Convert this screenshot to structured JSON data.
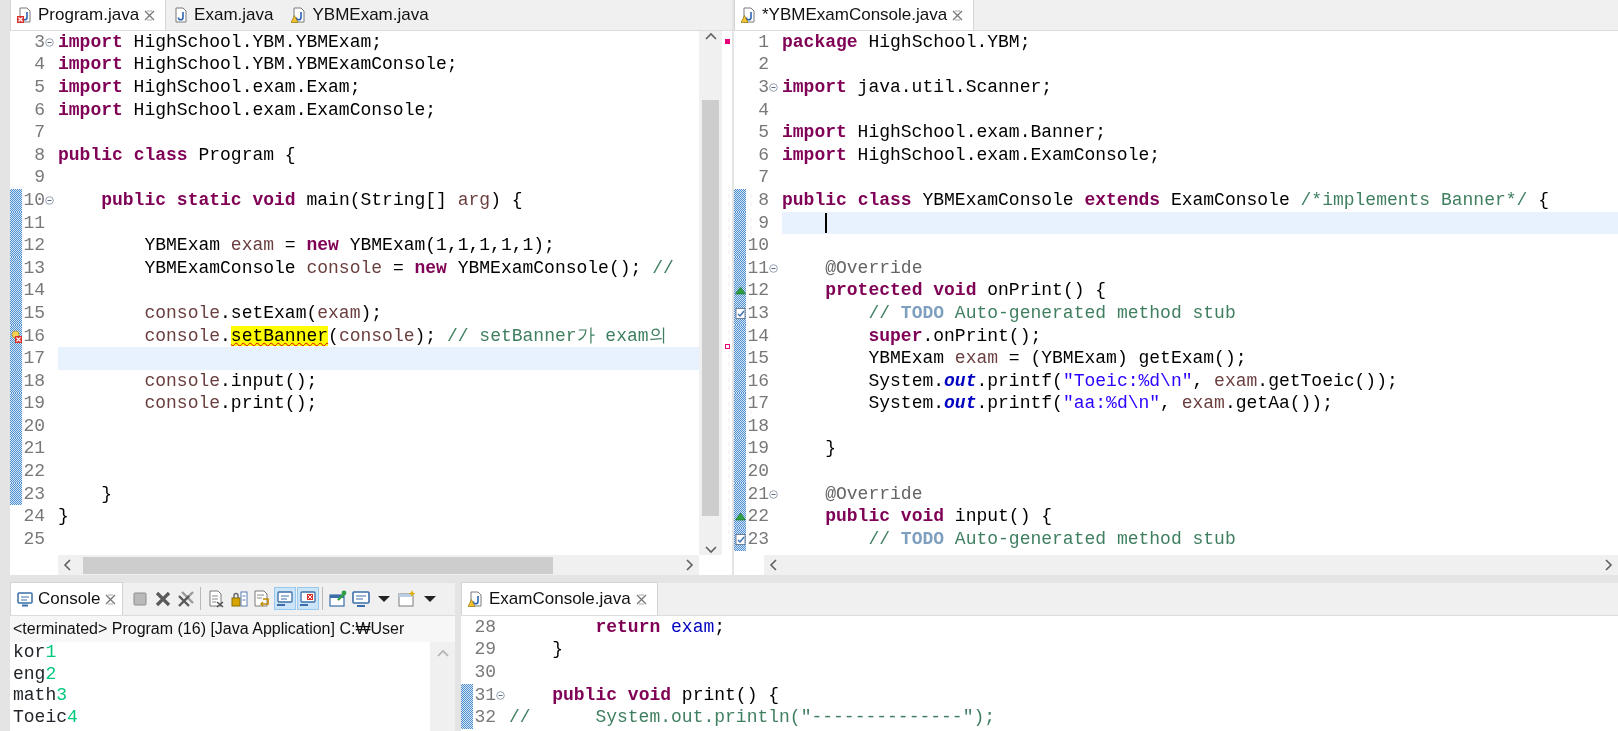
{
  "left_editor": {
    "cursor": false,
    "tabs": [
      {
        "label": "Program.java",
        "kind": "java-error",
        "selected": true
      },
      {
        "label": "Exam.java",
        "kind": "java",
        "selected": false
      },
      {
        "label": "YBMExam.java",
        "kind": "java-warning",
        "selected": false
      }
    ],
    "lines": [
      {
        "number": "3",
        "kind": "fold",
        "changed": false,
        "current": false,
        "tokens": [
          {
            "kind": "keyword",
            "text": "import"
          },
          {
            "kind": "plain",
            "text": " HighSchool.YBM.YBMExam;"
          }
        ]
      },
      {
        "number": "4",
        "kind": "plain",
        "changed": false,
        "current": false,
        "tokens": [
          {
            "kind": "keyword",
            "text": "import"
          },
          {
            "kind": "plain",
            "text": " HighSchool.YBM.YBMExamConsole;"
          }
        ]
      },
      {
        "number": "5",
        "kind": "plain",
        "changed": false,
        "current": false,
        "tokens": [
          {
            "kind": "keyword",
            "text": "import"
          },
          {
            "kind": "plain",
            "text": " HighSchool.exam.Exam;"
          }
        ]
      },
      {
        "number": "6",
        "kind": "plain",
        "changed": false,
        "current": false,
        "tokens": [
          {
            "kind": "keyword",
            "text": "import"
          },
          {
            "kind": "plain",
            "text": " HighSchool.exam.ExamConsole;"
          }
        ]
      },
      {
        "number": "7",
        "kind": "plain",
        "changed": false,
        "current": false
      },
      {
        "number": "8",
        "kind": "plain",
        "changed": false,
        "current": false,
        "tokens": [
          {
            "kind": "keyword",
            "text": "public "
          },
          {
            "kind": "keyword",
            "text": "class"
          },
          {
            "kind": "plain",
            "text": " Program {"
          }
        ]
      },
      {
        "number": "9",
        "kind": "plain",
        "changed": false,
        "current": false
      },
      {
        "number": "10",
        "kind": "fold",
        "changed": true,
        "current": false,
        "tokens": [
          {
            "kind": "keyword",
            "text": "    public "
          },
          {
            "kind": "keyword",
            "text": "static "
          },
          {
            "kind": "keyword",
            "text": "void"
          },
          {
            "kind": "plain",
            "text": " main(String[] "
          },
          {
            "kind": "local",
            "text": "arg"
          },
          {
            "kind": "plain",
            "text": ") {"
          }
        ]
      },
      {
        "number": "11",
        "kind": "plain",
        "changed": true,
        "current": false
      },
      {
        "number": "12",
        "kind": "plain",
        "changed": true,
        "current": false,
        "tokens": [
          {
            "kind": "plain",
            "text": "        YBMExam "
          },
          {
            "kind": "local",
            "text": "exam"
          },
          {
            "kind": "plain",
            "text": " = "
          },
          {
            "kind": "keyword",
            "text": "new"
          },
          {
            "kind": "plain",
            "text": " YBMExam(1,1,1,1,1);"
          }
        ]
      },
      {
        "number": "13",
        "kind": "plain",
        "changed": true,
        "current": false,
        "tokens": [
          {
            "kind": "plain",
            "text": "        YBMExamConsole "
          },
          {
            "kind": "local",
            "text": "console"
          },
          {
            "kind": "plain",
            "text": " = "
          },
          {
            "kind": "keyword",
            "text": "new"
          },
          {
            "kind": "plain",
            "text": " YBMExamConsole(); "
          },
          {
            "kind": "comment",
            "text": "//"
          }
        ]
      },
      {
        "number": "14",
        "kind": "plain",
        "changed": true,
        "current": false
      },
      {
        "number": "15",
        "kind": "plain",
        "changed": true,
        "current": false,
        "tokens": [
          {
            "kind": "local",
            "text": "        console"
          },
          {
            "kind": "plain",
            "text": ".setExam("
          },
          {
            "kind": "local",
            "text": "exam"
          },
          {
            "kind": "plain",
            "text": ");"
          }
        ]
      },
      {
        "number": "16",
        "kind": "error",
        "changed": true,
        "current": false,
        "tokens": [
          {
            "kind": "local",
            "text": "        console"
          },
          {
            "kind": "plain",
            "text": "."
          },
          {
            "kind": "error",
            "text": "setBanner"
          },
          {
            "kind": "plain",
            "text": "("
          },
          {
            "kind": "local",
            "text": "console"
          },
          {
            "kind": "plain",
            "text": "); "
          },
          {
            "kind": "comment",
            "text": "// setBanner가 exam의"
          }
        ]
      },
      {
        "number": "17",
        "kind": "plain",
        "changed": true,
        "current": true
      },
      {
        "number": "18",
        "kind": "plain",
        "changed": true,
        "current": false,
        "tokens": [
          {
            "kind": "local",
            "text": "        console"
          },
          {
            "kind": "plain",
            "text": ".input();"
          }
        ]
      },
      {
        "number": "19",
        "kind": "plain",
        "changed": true,
        "current": false,
        "tokens": [
          {
            "kind": "local",
            "text": "        console"
          },
          {
            "kind": "plain",
            "text": ".print();"
          }
        ]
      },
      {
        "number": "20",
        "kind": "plain",
        "changed": true,
        "current": false
      },
      {
        "number": "21",
        "kind": "plain",
        "changed": true,
        "current": false
      },
      {
        "number": "22",
        "kind": "plain",
        "changed": true,
        "current": false
      },
      {
        "number": "23",
        "kind": "plain",
        "changed": true,
        "current": false,
        "tokens": [
          {
            "kind": "plain",
            "text": "    }"
          }
        ]
      },
      {
        "number": "24",
        "kind": "plain",
        "changed": false,
        "current": false,
        "tokens": [
          {
            "kind": "plain",
            "text": "}"
          }
        ]
      },
      {
        "number": "25",
        "kind": "plain",
        "changed": false,
        "current": false
      }
    ]
  },
  "right_editor": {
    "cursor": true,
    "tabs": [
      {
        "label": "*YBMExamConsole.java",
        "kind": "java-warning",
        "selected": true
      }
    ],
    "lines": [
      {
        "number": "1",
        "kind": "plain",
        "changed": false,
        "current": false,
        "tokens": [
          {
            "kind": "keyword",
            "text": "package"
          },
          {
            "kind": "plain",
            "text": " HighSchool.YBM;"
          }
        ]
      },
      {
        "number": "2",
        "kind": "plain",
        "changed": false,
        "current": false
      },
      {
        "number": "3",
        "kind": "fold",
        "changed": false,
        "current": false,
        "tokens": [
          {
            "kind": "keyword",
            "text": "import"
          },
          {
            "kind": "plain",
            "text": " java.util.Scanner;"
          }
        ]
      },
      {
        "number": "4",
        "kind": "plain",
        "changed": false,
        "current": false
      },
      {
        "number": "5",
        "kind": "plain",
        "changed": false,
        "current": false,
        "tokens": [
          {
            "kind": "keyword",
            "text": "import"
          },
          {
            "kind": "plain",
            "text": " HighSchool.exam.Banner;"
          }
        ]
      },
      {
        "number": "6",
        "kind": "plain",
        "changed": false,
        "current": false,
        "tokens": [
          {
            "kind": "keyword",
            "text": "import"
          },
          {
            "kind": "plain",
            "text": " HighSchool.exam.ExamConsole;"
          }
        ]
      },
      {
        "number": "7",
        "kind": "plain",
        "changed": false,
        "current": false
      },
      {
        "number": "8",
        "kind": "plain",
        "changed": true,
        "current": false,
        "tokens": [
          {
            "kind": "keyword",
            "text": "public "
          },
          {
            "kind": "keyword",
            "text": "class"
          },
          {
            "kind": "plain",
            "text": " YBMExamConsole "
          },
          {
            "kind": "keyword",
            "text": "extends"
          },
          {
            "kind": "plain",
            "text": " ExamConsole "
          },
          {
            "kind": "comment",
            "text": "/*implements Banner*/"
          },
          {
            "kind": "plain",
            "text": " {"
          }
        ]
      },
      {
        "number": "9",
        "kind": "plain",
        "changed": true,
        "current": true
      },
      {
        "number": "10",
        "kind": "plain",
        "changed": true,
        "current": false
      },
      {
        "number": "11",
        "kind": "fold",
        "changed": true,
        "current": false,
        "tokens": [
          {
            "kind": "annotation",
            "text": "    @Override"
          }
        ]
      },
      {
        "number": "12",
        "kind": "override",
        "changed": true,
        "current": false,
        "tokens": [
          {
            "kind": "keyword",
            "text": "    protected "
          },
          {
            "kind": "keyword",
            "text": "void"
          },
          {
            "kind": "plain",
            "text": " onPrint() {"
          }
        ]
      },
      {
        "number": "13",
        "kind": "task",
        "changed": true,
        "current": false,
        "tokens": [
          {
            "kind": "comment",
            "text": "        // "
          },
          {
            "kind": "task",
            "text": "TODO"
          },
          {
            "kind": "comment",
            "text": " Auto-generated method stub"
          }
        ]
      },
      {
        "number": "14",
        "kind": "plain",
        "changed": true,
        "current": false,
        "tokens": [
          {
            "kind": "keyword",
            "text": "        super"
          },
          {
            "kind": "plain",
            "text": ".onPrint();"
          }
        ]
      },
      {
        "number": "15",
        "kind": "plain",
        "changed": true,
        "current": false,
        "tokens": [
          {
            "kind": "plain",
            "text": "        YBMExam "
          },
          {
            "kind": "local",
            "text": "exam"
          },
          {
            "kind": "plain",
            "text": " = (YBMExam) getExam();"
          }
        ]
      },
      {
        "number": "16",
        "kind": "plain",
        "changed": true,
        "current": false,
        "tokens": [
          {
            "kind": "plain",
            "text": "        System."
          },
          {
            "kind": "static_field",
            "text": "out"
          },
          {
            "kind": "plain",
            "text": ".printf("
          },
          {
            "kind": "string",
            "text": "\"Toeic:%d\\n\""
          },
          {
            "kind": "plain",
            "text": ", "
          },
          {
            "kind": "local",
            "text": "exam"
          },
          {
            "kind": "plain",
            "text": ".getToeic());"
          }
        ]
      },
      {
        "number": "17",
        "kind": "plain",
        "changed": true,
        "current": false,
        "tokens": [
          {
            "kind": "plain",
            "text": "        System."
          },
          {
            "kind": "static_field",
            "text": "out"
          },
          {
            "kind": "plain",
            "text": ".printf("
          },
          {
            "kind": "string",
            "text": "\"aa:%d\\n\""
          },
          {
            "kind": "plain",
            "text": ", "
          },
          {
            "kind": "local",
            "text": "exam"
          },
          {
            "kind": "plain",
            "text": ".getAa());"
          }
        ]
      },
      {
        "number": "18",
        "kind": "plain",
        "changed": true,
        "current": false
      },
      {
        "number": "19",
        "kind": "plain",
        "changed": true,
        "current": false,
        "tokens": [
          {
            "kind": "plain",
            "text": "    }"
          }
        ]
      },
      {
        "number": "20",
        "kind": "plain",
        "changed": true,
        "current": false
      },
      {
        "number": "21",
        "kind": "fold",
        "changed": true,
        "current": false,
        "tokens": [
          {
            "kind": "annotation",
            "text": "    @Override"
          }
        ]
      },
      {
        "number": "22",
        "kind": "override",
        "changed": true,
        "current": false,
        "tokens": [
          {
            "kind": "keyword",
            "text": "    public "
          },
          {
            "kind": "keyword",
            "text": "void"
          },
          {
            "kind": "plain",
            "text": " input() {"
          }
        ]
      },
      {
        "number": "23",
        "kind": "task",
        "changed": true,
        "current": false,
        "tokens": [
          {
            "kind": "comment",
            "text": "        // "
          },
          {
            "kind": "task",
            "text": "TODO"
          },
          {
            "kind": "comment",
            "text": " Auto-generated method stub"
          }
        ]
      }
    ]
  },
  "console": {
    "tabs": [
      {
        "label": "Console",
        "kind": "console",
        "selected": true
      }
    ],
    "toolbar_groups": [
      {
        "buttons": [
          {
            "kind": "terminate",
            "pressed": false
          },
          {
            "kind": "remove",
            "pressed": false
          },
          {
            "kind": "remove-all",
            "pressed": false
          }
        ]
      },
      {
        "buttons": [
          {
            "kind": "clear",
            "pressed": false
          },
          {
            "kind": "scroll-lock",
            "pressed": false
          },
          {
            "kind": "word-wrap",
            "pressed": false
          },
          {
            "kind": "show-stdout",
            "pressed": true
          },
          {
            "kind": "show-stderr",
            "pressed": true
          }
        ]
      },
      {
        "buttons": [
          {
            "kind": "pin",
            "pressed": false
          },
          {
            "kind": "display",
            "pressed": false
          },
          {
            "kind": "dropdown",
            "pressed": false
          },
          {
            "kind": "new-console",
            "pressed": false
          },
          {
            "kind": "dropdown",
            "pressed": false
          }
        ]
      }
    ],
    "description": "<terminated> Program (16) [Java Application] C:₩User",
    "output": [
      {
        "prompt": "kor",
        "input": "1"
      },
      {
        "prompt": "eng",
        "input": "2"
      },
      {
        "prompt": "math",
        "input": "3"
      },
      {
        "prompt": "Toeic",
        "input": "4"
      }
    ]
  },
  "bottom_editor": {
    "cursor": false,
    "tabs": [
      {
        "label": "ExamConsole.java",
        "kind": "java-warning",
        "selected": true
      }
    ],
    "lines": [
      {
        "number": "28",
        "kind": "plain",
        "changed": false,
        "current": false,
        "tokens": [
          {
            "kind": "keyword",
            "text": "        return "
          },
          {
            "kind": "field",
            "text": "exam"
          },
          {
            "kind": "plain",
            "text": ";"
          }
        ]
      },
      {
        "number": "29",
        "kind": "plain",
        "changed": false,
        "current": false,
        "tokens": [
          {
            "kind": "plain",
            "text": "    }"
          }
        ]
      },
      {
        "number": "30",
        "kind": "plain",
        "changed": false,
        "current": false
      },
      {
        "number": "31",
        "kind": "fold",
        "changed": true,
        "current": false,
        "tokens": [
          {
            "kind": "keyword",
            "text": "    public "
          },
          {
            "kind": "keyword",
            "text": "void"
          },
          {
            "kind": "plain",
            "text": " print() {"
          }
        ]
      },
      {
        "number": "32",
        "kind": "plain",
        "changed": true,
        "current": false,
        "tokens": [
          {
            "kind": "comment",
            "text": "//      System.out.println(\"--------------\");"
          }
        ]
      }
    ]
  }
}
